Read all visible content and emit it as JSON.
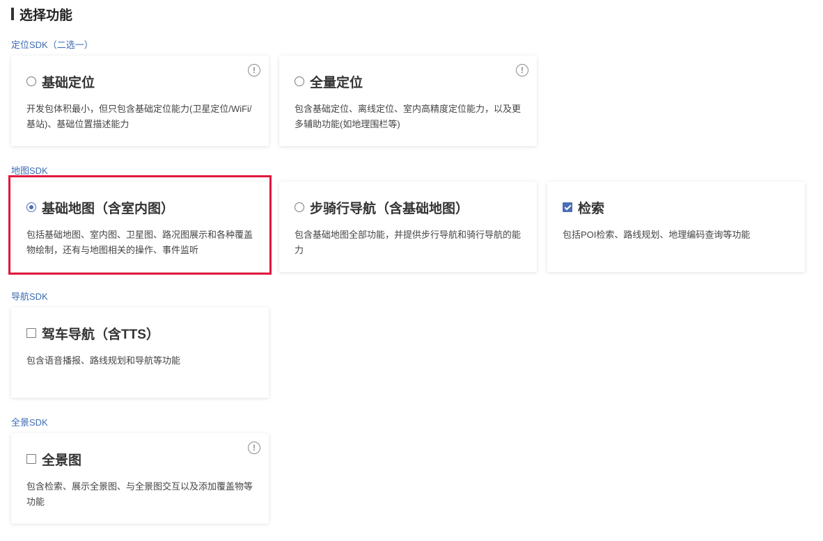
{
  "page": {
    "title": "选择功能"
  },
  "groups": [
    {
      "label": "定位SDK（二选一）",
      "cards": [
        {
          "title": "基础定位",
          "control": "radio",
          "checked": false,
          "info_icon": true,
          "desc": "开发包体积最小，但只包含基础定位能力(卫星定位/WiFi/基站)、基础位置描述能力"
        },
        {
          "title": "全量定位",
          "control": "radio",
          "checked": false,
          "info_icon": true,
          "desc": "包含基础定位、离线定位、室内高精度定位能力，以及更多辅助功能(如地理围栏等)"
        }
      ]
    },
    {
      "label": "地图SDK",
      "cards": [
        {
          "title": "基础地图（含室内图）",
          "control": "radio",
          "checked": true,
          "info_icon": false,
          "desc": "包括基础地图、室内图、卫星图、路况图展示和各种覆盖物绘制，还有与地图相关的操作、事件监听"
        },
        {
          "title": "步骑行导航（含基础地图）",
          "control": "radio",
          "checked": false,
          "info_icon": false,
          "desc": "包含基础地图全部功能，并提供步行导航和骑行导航的能力"
        },
        {
          "title": "检索",
          "control": "checkbox",
          "checked": true,
          "info_icon": false,
          "desc": "包括POI检索、路线规划、地理编码查询等功能"
        }
      ]
    },
    {
      "label": "导航SDK",
      "cards": [
        {
          "title": "驾车导航（含TTS）",
          "control": "checkbox",
          "checked": false,
          "info_icon": false,
          "desc": "包含语音播报、路线规划和导航等功能"
        }
      ]
    },
    {
      "label": "全景SDK",
      "cards": [
        {
          "title": "全景图",
          "control": "checkbox",
          "checked": false,
          "info_icon": true,
          "desc": "包含检索、展示全景图、与全景图交互以及添加覆盖物等功能"
        }
      ]
    }
  ],
  "info_icon_glyph": "!",
  "colors": {
    "accent": "#4a6fb5",
    "highlight": "#e0173f",
    "group_label": "#3b6bb3"
  }
}
